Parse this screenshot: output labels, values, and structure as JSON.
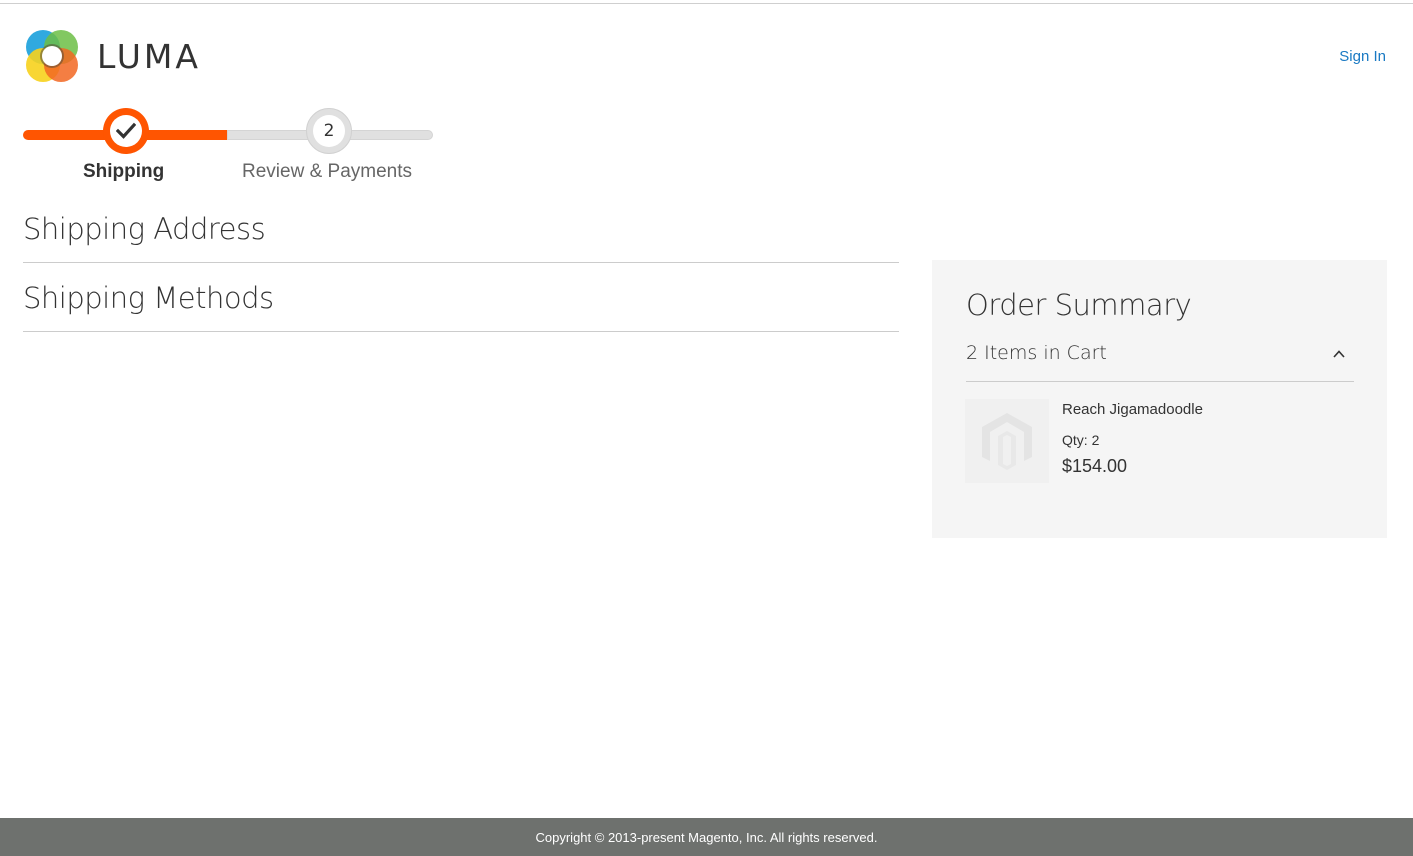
{
  "header": {
    "logo_text": "LUMA",
    "sign_in_label": "Sign In"
  },
  "progress": {
    "steps": [
      {
        "label": "Shipping",
        "state": "complete",
        "indicator": "check-icon"
      },
      {
        "label": "Review & Payments",
        "state": "pending",
        "number": "2"
      }
    ],
    "active_color": "#ff5501",
    "inactive_color": "#e0e0e0"
  },
  "main": {
    "sections": [
      {
        "title": "Shipping Address"
      },
      {
        "title": "Shipping Methods"
      }
    ]
  },
  "order_summary": {
    "title": "Order Summary",
    "cart_count_label": "2 Items in Cart",
    "toggle_icon": "chevron-up-icon",
    "items": [
      {
        "name": "Reach Jigamadoodle",
        "qty_label": "Qty:",
        "qty": "2",
        "price": "$154.00",
        "thumbnail_icon": "magento-placeholder-icon"
      }
    ]
  },
  "footer": {
    "copyright": "Copyright © 2013-present Magento, Inc. All rights reserved."
  },
  "colors": {
    "link": "#1979c3",
    "accent": "#ff5501",
    "footer_bg": "#6e716e",
    "summary_bg": "#f5f5f5"
  }
}
